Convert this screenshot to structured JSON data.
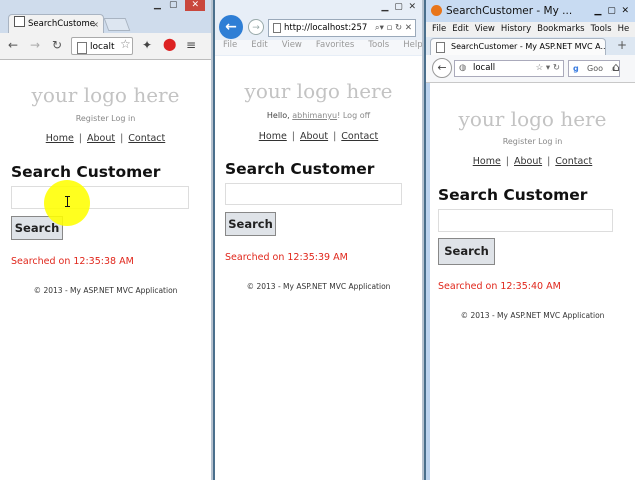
{
  "logo_text": "your logo here",
  "page_heading": "Search Customer",
  "search_button_label": "Search",
  "footer": "© 2013 - My ASP.NET MVC Application",
  "nav": {
    "home": "Home",
    "about": "About",
    "contact": "Contact",
    "sep": "|"
  },
  "chrome": {
    "tab_title": "SearchCustome",
    "tab_close": "×",
    "address": "localt",
    "register": "Register",
    "login": "Log in",
    "message": "Searched on 12:35:38 AM"
  },
  "ie": {
    "address": "http://localhost:257",
    "menu": [
      "File",
      "Edit",
      "View",
      "Favorites",
      "Tools",
      "Help"
    ],
    "hello": "Hello,",
    "username": "abhimanyu",
    "hello_suffix": "!",
    "logoff": "Log off",
    "message": "Searched on 12:35:39 AM"
  },
  "firefox": {
    "window_title": "SearchCustomer - My ...",
    "menu": [
      "File",
      "Edit",
      "View",
      "History",
      "Bookmarks",
      "Tools",
      "He"
    ],
    "tab_title": "SearchCustomer - My ASP.NET MVC A...",
    "address": "locall",
    "search_engine": "Goo",
    "register": "Register",
    "login": "Log in",
    "message": "Searched on 12:35:40 AM"
  },
  "colors": {
    "error_red": "#e0261b",
    "logo_gray": "#c3c3c3"
  }
}
